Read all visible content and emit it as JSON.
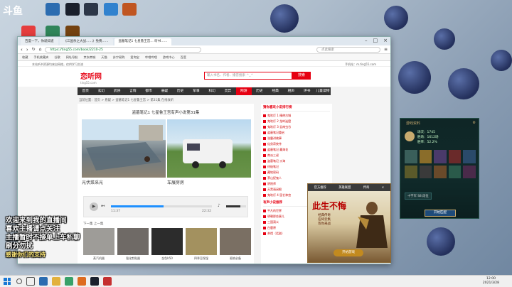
{
  "stream": {
    "logo": "斗鱼",
    "overlay_lines": [
      "欢迎来到我的直播间",
      "喜欢主播请点关注",
      "主播暂时不接单上车私聊",
      "刷分勿扰",
      "感谢你们的支持"
    ]
  },
  "browser": {
    "tabs": [
      "百度一下，你就知道",
      "《三国杀之大战……》免费……",
      "盗墓笔记1 七星鲁王宫… 听书……"
    ],
    "url": "https://ting55.com/book/2210-25",
    "search_placeholder": "点此搜索",
    "bookmarks": [
      "收藏",
      "手机收藏夹",
      "谷歌",
      "网址导航",
      "京东商城",
      "天猫",
      "苏宁易购",
      "爱淘宝",
      "哔哩哔哩",
      "游戏中心",
      "百度"
    ]
  },
  "site": {
    "topline_left": "本站听书资源均来自网络，仅供学习交流",
    "topline_right": "手机站：m.ting55.com",
    "logo": "恋听网",
    "logo_sub": "ting55.com",
    "search_placeholder": "输入书名、作者、播音搜索 ^_^",
    "search_btn": "搜索",
    "nav": [
      "首页",
      "玄幻",
      "武侠",
      "言情",
      "都市",
      "悬疑",
      "历史",
      "军事",
      "科幻",
      "灵异",
      "网游",
      "历史",
      "经典",
      "相声",
      "评书",
      "儿童读物"
    ],
    "nav_active": 10,
    "breadcrumb": "当前位置：首页 > 悬疑 > 盗墓笔记1 七星鲁王宫 > 第31集 在线收听",
    "title": "盗墓笔记1 七星鲁王宫有声小说第31集",
    "photos": [
      {
        "caption": "光伏菜采光",
        "name": "solar-roof-photo"
      },
      {
        "caption": "车展房房",
        "name": "rv-camper-photo"
      }
    ],
    "player": {
      "elapsed": "11:37",
      "total": "22:32",
      "progress": 0.52,
      "volume": 0.7
    },
    "related_label": "下一集  上一集",
    "thumbs": [
      "蒸汽机器",
      "强化剪贴器",
      "金色b50",
      "四季豆保湿",
      "驱蚊必备"
    ],
    "sidebar_title": "猜你喜欢小说排行榜",
    "sidebar_items": [
      "鬼吹灯 1 精绝古城",
      "鬼吹灯 2 龙岭迷窟",
      "鬼吹灯 3 云南虫谷",
      "盗墓笔记重启",
      "张震讲故事",
      "仙剑奇侠传",
      "盗墓笔记 藏海花",
      "南派三叔",
      "盗墓笔记 沙海",
      "终极笔记",
      "藏地密码",
      "茅山捉鬼人",
      "阴阳师",
      "天黑请闭眼",
      "鬼吹灯 4 昆仑神宫"
    ],
    "sidebar_section2": "有声小说推荐",
    "sidebar_items2": [
      "平凡的世界",
      "明朝那些事儿",
      "三国演义",
      "白鹿原",
      "茶馆（话剧）"
    ]
  },
  "ad": {
    "tabs": [
      "官方推荐",
      "英雄联盟",
      "传奇"
    ],
    "title": "此生不悔",
    "text": [
      "经典传奇",
      "名将云集",
      "等你来战"
    ],
    "button": "开始游戏"
  },
  "client": {
    "title": "游戏资料",
    "stats": [
      "场次：1745",
      "胜场：1612场",
      "胜率：52.2%"
    ],
    "row1": "十字军 S8 段位",
    "button": "开始匹配"
  },
  "taskbar": {
    "time": "12:00",
    "date": "2021/3/28"
  }
}
